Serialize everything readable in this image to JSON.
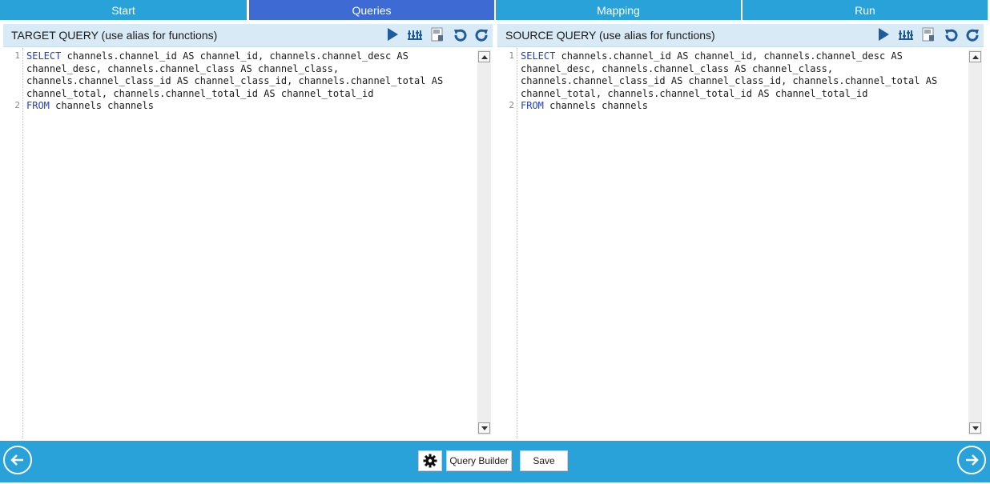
{
  "tabs": [
    {
      "label": "Start"
    },
    {
      "label": "Queries"
    },
    {
      "label": "Mapping"
    },
    {
      "label": "Run"
    }
  ],
  "active_tab": "Queries",
  "colors": {
    "tab": "#29a1d9",
    "active_tab": "#3d6bd3",
    "header": "#d9eaf7",
    "keyword": "#1f3fcf"
  },
  "target": {
    "title": "TARGET QUERY (use alias for functions)",
    "line_numbers": [
      "1",
      "2"
    ],
    "lines": [
      {
        "kw": "SELECT",
        "text": " channels.channel_id AS channel_id, channels.channel_desc AS"
      },
      {
        "kw": "",
        "text": "channel_desc, channels.channel_class AS channel_class,"
      },
      {
        "kw": "",
        "text": "channels.channel_class_id AS channel_class_id, channels.channel_total AS"
      },
      {
        "kw": "",
        "text": "channel_total, channels.channel_total_id AS channel_total_id"
      },
      {
        "kw": "FROM",
        "text": " channels channels"
      }
    ]
  },
  "source": {
    "title": "SOURCE QUERY (use alias for functions)",
    "line_numbers": [
      "1",
      "2"
    ],
    "lines": [
      {
        "kw": "SELECT",
        "text": " channels.channel_id AS channel_id, channels.channel_desc AS"
      },
      {
        "kw": "",
        "text": "channel_desc, channels.channel_class AS channel_class,"
      },
      {
        "kw": "",
        "text": "channels.channel_class_id AS channel_class_id, channels.channel_total AS"
      },
      {
        "kw": "",
        "text": "channel_total, channels.channel_total_id AS channel_total_id"
      },
      {
        "kw": "FROM",
        "text": " channels channels"
      }
    ]
  },
  "toolbar_icons": [
    "run-icon",
    "columns-icon",
    "save-query-icon",
    "undo-icon",
    "redo-icon"
  ],
  "bottom": {
    "query_builder_label": "Query Builder",
    "save_label": "Save"
  }
}
